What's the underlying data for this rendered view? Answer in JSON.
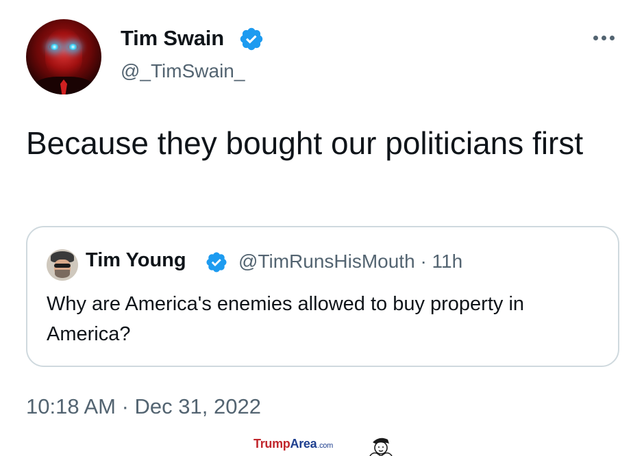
{
  "tweet": {
    "author": {
      "display_name": "Tim Swain",
      "handle": "@_TimSwain_",
      "verified_icon": "verified-badge-icon"
    },
    "text": "Because they bought our politicians first",
    "timestamp": "10:18 AM · Dec 31, 2022",
    "more_icon": "more-horizontal-icon"
  },
  "quoted_tweet": {
    "author": {
      "display_name": "Tim Young",
      "handle": "@TimRunsHisMouth",
      "age": "11h",
      "verified_icon": "verified-badge-icon"
    },
    "meta": "@TimRunsHisMouth · 11h",
    "text": "Why are America's enemies allowed to buy property in America?"
  },
  "watermark": {
    "part1": "Trump",
    "part2": "Area",
    "part3": ".com"
  },
  "colors": {
    "verified_blue": "#1d9bf0",
    "secondary_text": "#536471",
    "card_border": "#cfd9de",
    "watermark_red": "#c1272d",
    "watermark_blue": "#1e3f8f"
  }
}
